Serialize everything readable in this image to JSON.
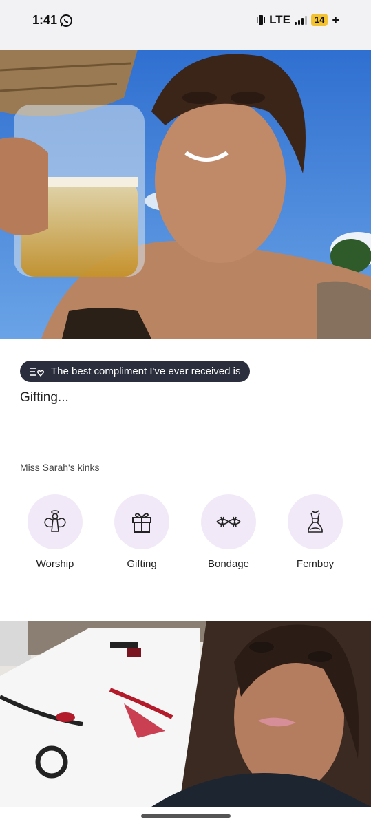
{
  "status_bar": {
    "time": "1:41",
    "network": "LTE",
    "battery_level": "14",
    "battery_plus": "+",
    "icons": [
      "whatsapp-icon",
      "vibrate-icon",
      "signal-icon",
      "battery-icon"
    ]
  },
  "prompt": {
    "question": "The best compliment I've ever received is",
    "answer": "Gifting...",
    "icon": "prompt-heart-icon"
  },
  "kinks": {
    "title": "Miss Sarah's kinks",
    "items": [
      {
        "label": "Worship",
        "icon": "angel-icon"
      },
      {
        "label": "Gifting",
        "icon": "gift-icon"
      },
      {
        "label": "Bondage",
        "icon": "barbed-wire-icon"
      },
      {
        "label": "Femboy",
        "icon": "dress-icon"
      }
    ]
  },
  "colors": {
    "chip_bg": "#2b2f3d",
    "kink_circle_bg": "#f1e9f7",
    "battery": "#f3c230"
  }
}
